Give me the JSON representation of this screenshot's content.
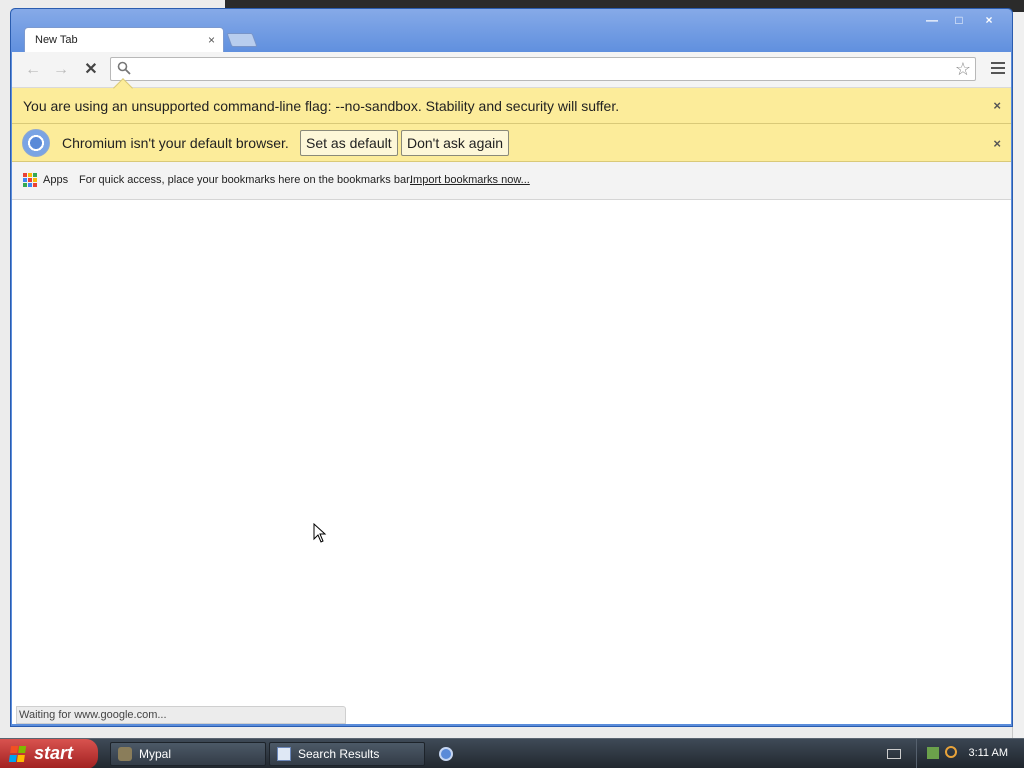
{
  "browser": {
    "tab": {
      "title": "New Tab",
      "close": "×"
    },
    "window_controls": {
      "minimize": "—",
      "maximize": "□",
      "close": "×"
    },
    "toolbar": {
      "back": "←",
      "forward": "→",
      "stop": "✕",
      "omnibox_value": "",
      "star": "☆"
    },
    "infobar_flag": {
      "text": "You are using an unsupported command-line flag: --no-sandbox. Stability and security will suffer.",
      "close": "×"
    },
    "infobar_default": {
      "text": "Chromium isn't your default browser.",
      "set_default": "Set as default",
      "dont_ask": "Don't ask again",
      "close": "×"
    },
    "bookmarks_bar": {
      "apps_label": "Apps",
      "hint": "For quick access, place your bookmarks here on the bookmarks bar.",
      "import_link": "Import bookmarks now..."
    },
    "status_text": "Waiting for www.google.com..."
  },
  "taskbar": {
    "start_label": "start",
    "tasks": [
      {
        "label": "Mypal"
      },
      {
        "label": "Search Results"
      }
    ],
    "clock": "3:11 AM"
  },
  "colors": {
    "frame": "#5b8ddb",
    "infobar": "#fcec9a",
    "taskbar": "#2d353e",
    "start": "#c0392b"
  }
}
